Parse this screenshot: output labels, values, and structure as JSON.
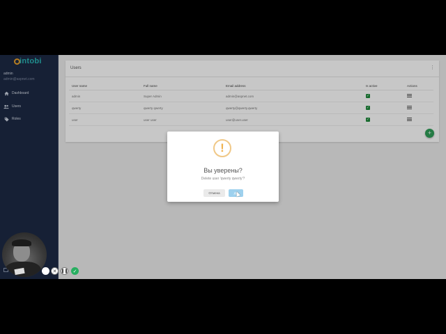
{
  "app": {
    "logo_text": "intobi"
  },
  "user": {
    "name": "admin",
    "email": "admin@aspnet.com"
  },
  "sidebar": {
    "items": [
      {
        "label": "Dashboard",
        "icon": "home-icon"
      },
      {
        "label": "Users",
        "icon": "users-icon"
      },
      {
        "label": "Roles",
        "icon": "tag-icon"
      }
    ]
  },
  "card": {
    "title": "Users",
    "menu_icon": "more-vertical-icon",
    "table": {
      "headers": [
        "User name",
        "Full name",
        "Email address",
        "Is active",
        "Actions"
      ],
      "rows": [
        {
          "username": "admin",
          "fullname": "Super Admin",
          "email": "admin@aspnet.com",
          "active": true
        },
        {
          "username": "qwerty",
          "fullname": "qwerty qwerty",
          "email": "qwerty@qwerty.qwerty",
          "active": true
        },
        {
          "username": "user",
          "fullname": "user user",
          "email": "user@user.user",
          "active": true
        }
      ]
    },
    "add_button": "+"
  },
  "dialog": {
    "icon": "!",
    "title": "Вы уверены?",
    "text": "Delete user 'qwerty qwerty'?",
    "cancel_label": "Отмена",
    "ok_label": "Да"
  },
  "recorder": {
    "icons": [
      "record-icon",
      "close-icon",
      "pause-icon",
      "check-icon"
    ]
  },
  "colors": {
    "sidebar": "#1d2a44",
    "accent": "#2f9e58",
    "dialog_ok": "#9ed1ee",
    "warning": "#f0c887"
  }
}
